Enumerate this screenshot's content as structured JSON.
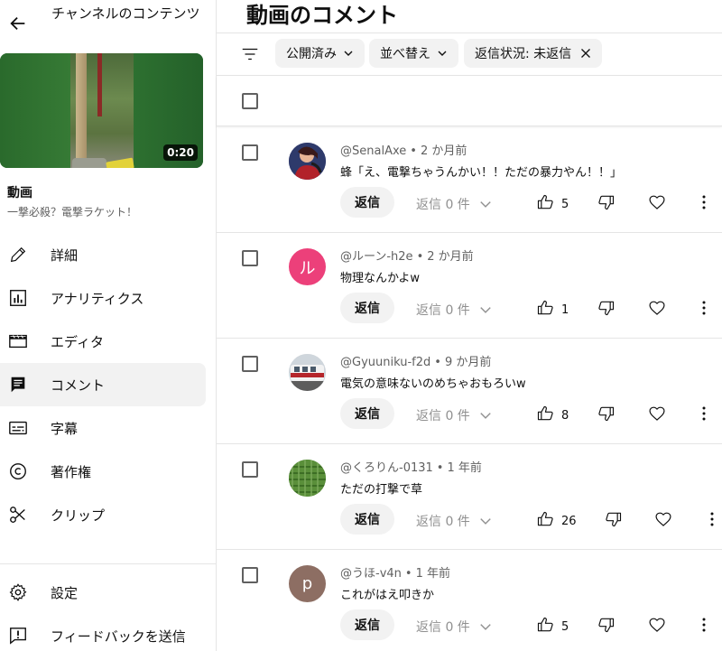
{
  "sidebar": {
    "channel_title": "チャンネルのコンテンツ",
    "thumbnail_duration": "0:20",
    "video_label": "動画",
    "video_title": "一撃必殺？電撃ラケット！",
    "nav": [
      {
        "label": "詳細",
        "icon": "pencil-icon"
      },
      {
        "label": "アナリティクス",
        "icon": "analytics-icon"
      },
      {
        "label": "エディタ",
        "icon": "clapperboard-icon"
      },
      {
        "label": "コメント",
        "icon": "comment-icon",
        "active": true
      },
      {
        "label": "字幕",
        "icon": "subtitles-icon"
      },
      {
        "label": "著作権",
        "icon": "copyright-icon"
      },
      {
        "label": "クリップ",
        "icon": "scissors-icon"
      }
    ],
    "bottom_nav": [
      {
        "label": "設定",
        "icon": "gear-icon"
      },
      {
        "label": "フィードバックを送信",
        "icon": "feedback-icon"
      }
    ]
  },
  "main": {
    "page_title": "動画のコメント",
    "filters": {
      "published": "公開済み",
      "sort": "並べ替え",
      "reply_status": "返信状況: 未返信"
    },
    "comments": [
      {
        "author": "@SenalAxe",
        "time": "2 か月前",
        "text": "蜂「え、電撃ちゃうんかい！！ただの暴力やん！！」",
        "reply_label": "返信",
        "replies": "返信 0 件",
        "likes": "5",
        "avatar": "photo"
      },
      {
        "author": "@ルーン-h2e",
        "time": "2 か月前",
        "text": "物理なんかよw",
        "reply_label": "返信",
        "replies": "返信 0 件",
        "likes": "1",
        "avatar_letter": "ル",
        "avatar_color": "#ec407a"
      },
      {
        "author": "@Gyuuniku-f2d",
        "time": "9 か月前",
        "text": "電気の意味ないのめちゃおもろいw",
        "reply_label": "返信",
        "replies": "返信 0 件",
        "likes": "8",
        "avatar": "photo"
      },
      {
        "author": "@くろりん-0131",
        "time": "1 年前",
        "text": "ただの打撃で草",
        "reply_label": "返信",
        "replies": "返信 0 件",
        "likes": "26",
        "avatar": "photo"
      },
      {
        "author": "@うほ-v4n",
        "time": "1 年前",
        "text": "これがはえ叩きか",
        "reply_label": "返信",
        "replies": "返信 0 件",
        "likes": "5",
        "avatar_letter": "p",
        "avatar_color": "#8d6e63"
      }
    ]
  },
  "colors": {
    "chip_bg": "#f2f2f2",
    "active_nav_bg": "#f2f2f2",
    "secondary_text": "#606060"
  }
}
